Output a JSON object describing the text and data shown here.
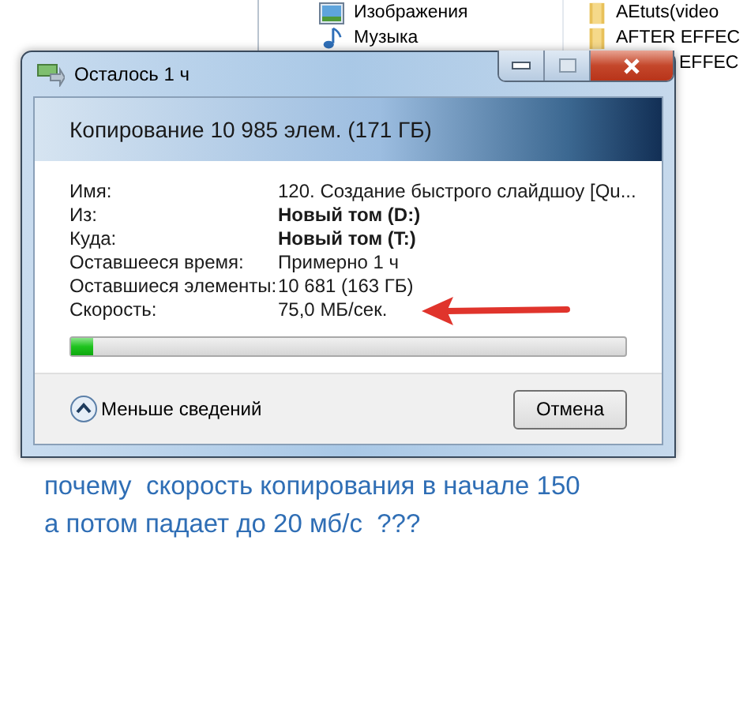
{
  "explorer": {
    "nav_items": [
      {
        "label": "Изображения",
        "kind": "pictures"
      },
      {
        "label": "Музыка",
        "kind": "music"
      }
    ],
    "files": [
      {
        "name": "AEtuts(video"
      },
      {
        "name": "AFTER EFFEC"
      }
    ],
    "partly_covered_file": "EFFEC"
  },
  "window": {
    "title": "Осталось 1 ч"
  },
  "header": "Копирование 10 985 элем. (171 ГБ)",
  "details": [
    {
      "label": "Имя:",
      "value": "120. Создание быстрого слайдшоу [Qu...",
      "bold": false
    },
    {
      "label": "Из:",
      "value": "Новый том (D:)",
      "bold": true
    },
    {
      "label": "Куда:",
      "value": "Новый том (T:)",
      "bold": true
    },
    {
      "label": "Оставшееся время:",
      "value": "Примерно 1 ч",
      "bold": false
    },
    {
      "label": "Оставшиеся элементы:",
      "value": "10 681 (163 ГБ)",
      "bold": false
    },
    {
      "label": "Скорость:",
      "value": "75,0 МБ/сек.",
      "bold": false
    }
  ],
  "progress": {
    "level": 0.04
  },
  "footer": {
    "details_toggle": "Меньше сведений",
    "cancel": "Отмена"
  },
  "annotation": [
    "почему  скорость копирования в начале 150",
    "а потом падает до 20 мб/с  ???"
  ]
}
